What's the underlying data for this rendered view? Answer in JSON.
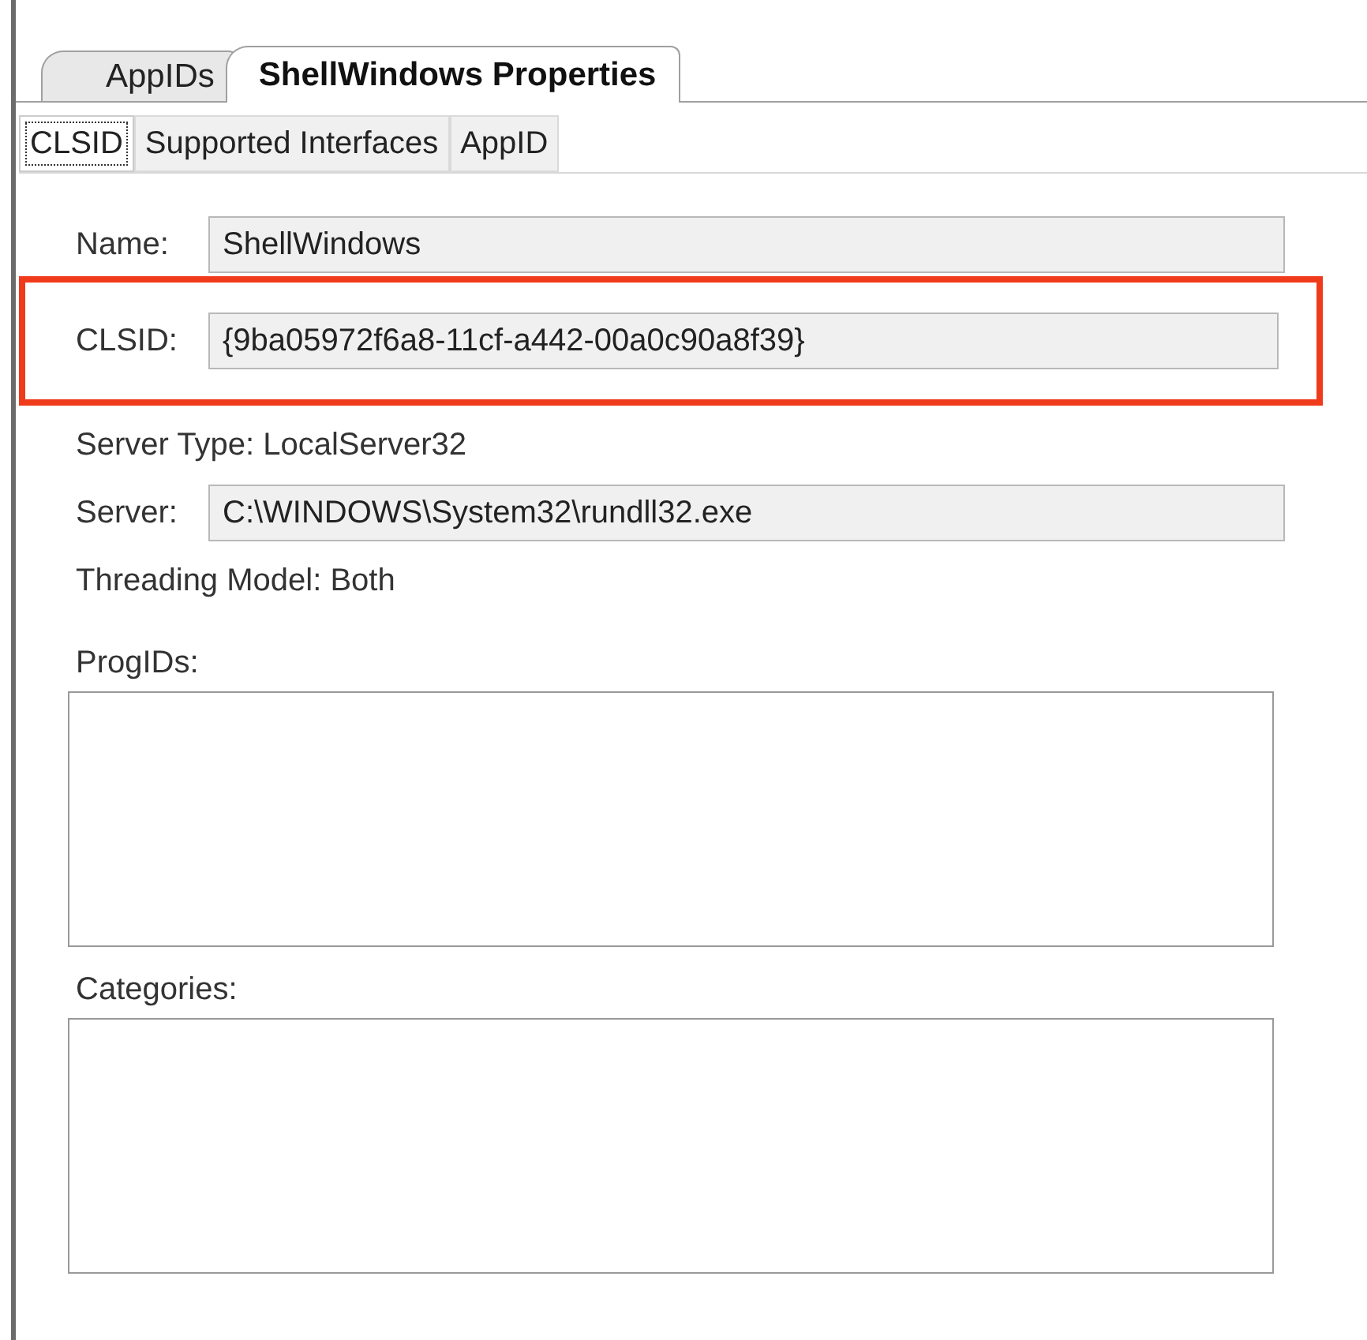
{
  "outer_tabs": [
    {
      "label": "AppIDs",
      "selected": false
    },
    {
      "label": "ShellWindows Properties",
      "selected": true
    }
  ],
  "inner_tabs": [
    {
      "label": "CLSID",
      "selected": true
    },
    {
      "label": "Supported Interfaces",
      "selected": false
    },
    {
      "label": "AppID",
      "selected": false
    }
  ],
  "rows": [
    {
      "kind": "field",
      "label": "Name:",
      "value": "ShellWindows",
      "highlighted": false
    },
    {
      "kind": "field",
      "label": "CLSID:",
      "value": "{9ba05972f6a8-11cf-a442-00a0c90a8f39}",
      "highlighted": true
    },
    {
      "kind": "text",
      "text": "Server Type: LocalServer32"
    },
    {
      "kind": "field",
      "label": "Server:",
      "value": "C:\\WINDOWS\\System32\\rundll32.exe",
      "highlighted": false
    },
    {
      "kind": "text",
      "text": "Threading Model: Both"
    }
  ],
  "lists": [
    {
      "label": "ProgIDs:"
    },
    {
      "label": "Categories:"
    }
  ]
}
